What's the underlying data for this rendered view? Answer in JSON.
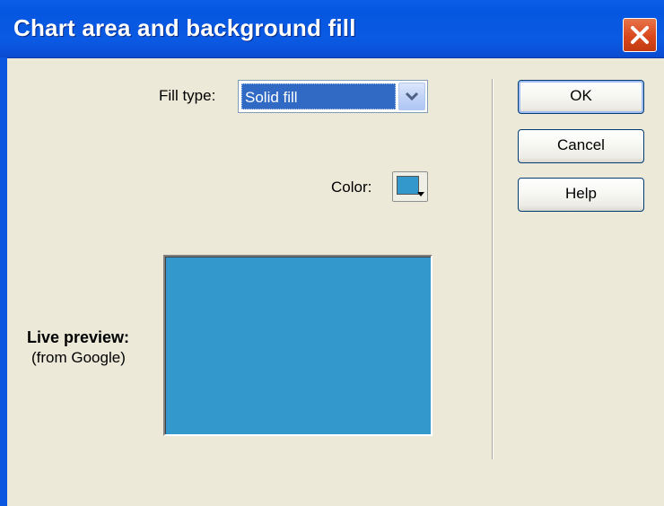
{
  "window": {
    "title": "Chart area and background fill"
  },
  "fill_type": {
    "label": "Fill type:",
    "selected": "Solid fill"
  },
  "color": {
    "label": "Color:",
    "value": "#3399cc"
  },
  "preview": {
    "label": "Live preview:",
    "source": "(from Google)",
    "fill_color": "#3399cc"
  },
  "buttons": {
    "ok": "OK",
    "cancel": "Cancel",
    "help": "Help"
  },
  "icons": {
    "close": "close-icon",
    "dropdown": "chevron-down-icon",
    "color_dropdown": "triangle-down-icon"
  }
}
